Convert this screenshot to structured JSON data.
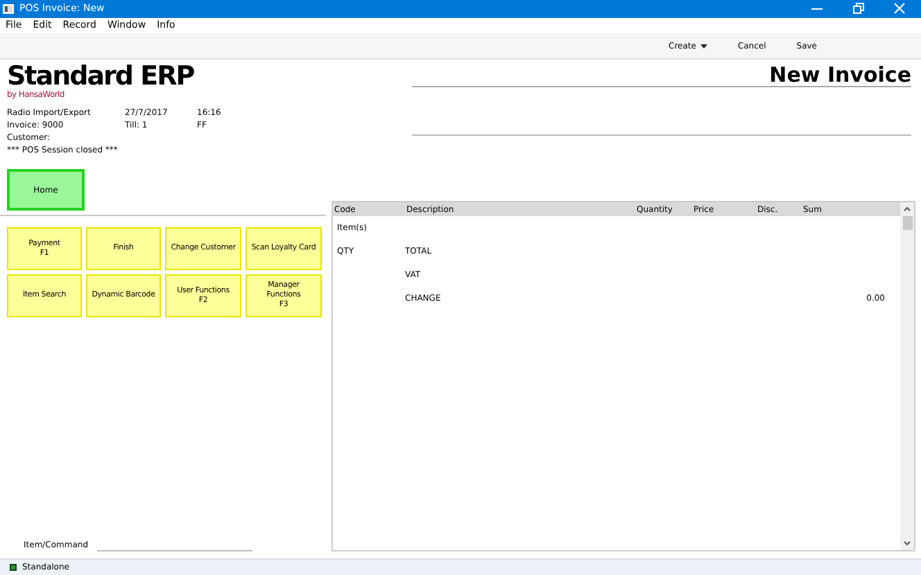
{
  "window": {
    "title": "POS Invoice: New"
  },
  "menu": [
    "File",
    "Edit",
    "Record",
    "Window",
    "Info"
  ],
  "toolbar": [
    {
      "label": "Create",
      "kind": "dropdown"
    },
    {
      "label": "Cancel",
      "kind": "button"
    },
    {
      "label": "Save",
      "kind": "button"
    }
  ],
  "logo": {
    "name": "Standard ERP",
    "byline": "by HansaWorld"
  },
  "heading": "New Invoice",
  "info": [
    [
      "Radio Import/Export",
      "27/7/2017",
      "16:16"
    ],
    [
      "Invoice: 9000",
      "Till: 1",
      "FF"
    ],
    [
      "Customer:"
    ],
    [
      "*** POS Session closed ***"
    ]
  ],
  "home_button": {
    "label": "Home"
  },
  "function_buttons": [
    {
      "lines": [
        "Payment",
        "F1"
      ]
    },
    {
      "lines": [
        "Finish"
      ]
    },
    {
      "lines": [
        "Change Customer"
      ]
    },
    {
      "lines": [
        "Scan Loyalty Card"
      ]
    },
    {
      "lines": [
        "Item Search"
      ]
    },
    {
      "lines": [
        "Dynamic Barcode"
      ]
    },
    {
      "lines": [
        "User Functions",
        "F2"
      ]
    },
    {
      "lines": [
        "Manager",
        "Functions",
        "F3"
      ]
    }
  ],
  "table": {
    "columns": [
      "Code",
      "Description",
      "Quantity",
      "Price",
      "Disc.",
      "Sum"
    ],
    "rows": [
      {
        "code": "Item(s)"
      },
      {
        "code": "QTY",
        "description": "TOTAL"
      },
      {
        "description": "VAT"
      },
      {
        "description": "CHANGE",
        "sum": "0.00"
      }
    ]
  },
  "command": {
    "label": "Item/Command"
  },
  "status_bar": {
    "text": "Standalone"
  }
}
